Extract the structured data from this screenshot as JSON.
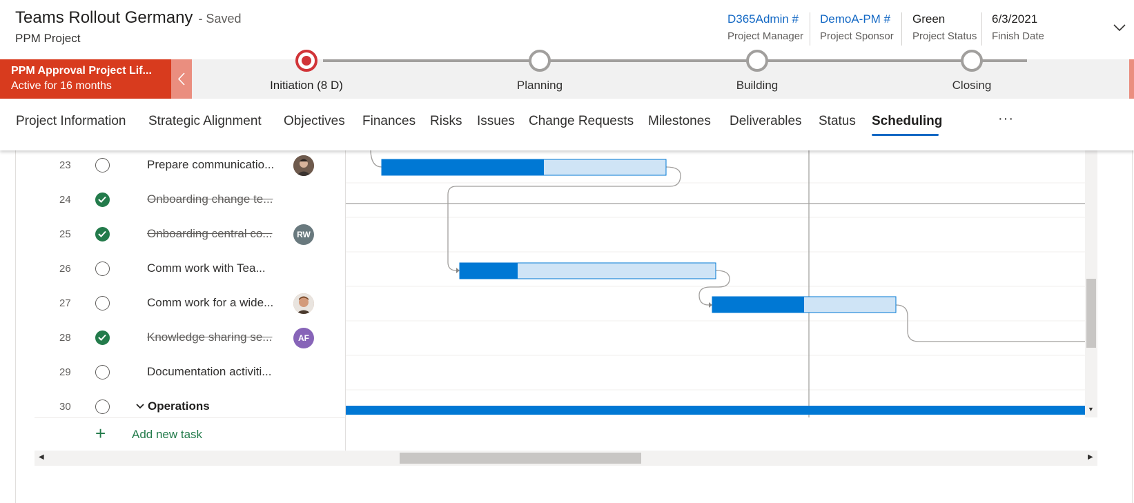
{
  "header": {
    "title": "Teams Rollout Germany",
    "saved_state": "- Saved",
    "entity_type": "PPM Project",
    "fields": [
      {
        "value": "D365Admin #",
        "label": "Project Manager",
        "is_link": true
      },
      {
        "value": "DemoA-PM #",
        "label": "Project Sponsor",
        "is_link": true
      },
      {
        "value": "Green",
        "label": "Project Status",
        "is_link": false
      },
      {
        "value": "6/3/2021",
        "label": "Finish Date",
        "is_link": false
      }
    ],
    "expand_icon": "chevron-down-icon"
  },
  "process_flow": {
    "active_process_name": "PPM Approval Project Lif...",
    "active_duration": "Active for 16 months",
    "collapse_icon": "chevron-left-icon",
    "stages": [
      {
        "label": "Initiation  (8 D)",
        "active": true
      },
      {
        "label": "Planning",
        "active": false
      },
      {
        "label": "Building",
        "active": false
      },
      {
        "label": "Closing",
        "active": false
      }
    ]
  },
  "tabs": {
    "items": [
      "Project Information",
      "Strategic Alignment",
      "Objectives",
      "Finances",
      "Risks",
      "Issues",
      "Change Requests",
      "Milestones",
      "Deliverables",
      "Status",
      "Scheduling"
    ],
    "selected": "Scheduling",
    "more_label": "···"
  },
  "schedule": {
    "tasks": [
      {
        "num": "23",
        "name": "Prepare communicatio...",
        "done": false,
        "avatar": "photo"
      },
      {
        "num": "24",
        "name": "Onboarding change te...",
        "done": true,
        "avatar": ""
      },
      {
        "num": "25",
        "name": "Onboarding central co...",
        "done": true,
        "avatar": "RW",
        "avatar_color": "#69797e"
      },
      {
        "num": "26",
        "name": "Comm work with Tea...",
        "done": false,
        "avatar": ""
      },
      {
        "num": "27",
        "name": "Comm work for a wide...",
        "done": false,
        "avatar": "photo2"
      },
      {
        "num": "28",
        "name": "Knowledge sharing se...",
        "done": true,
        "avatar": "AF",
        "avatar_color": "#8764b8"
      },
      {
        "num": "29",
        "name": "Documentation activiti...",
        "done": false,
        "avatar": ""
      },
      {
        "num": "30",
        "name": "Operations",
        "done": false,
        "group": true,
        "avatar": ""
      }
    ],
    "add_task_label": "Add new task",
    "add_icon": "plus-icon"
  },
  "colors": {
    "accent": "#1368c4",
    "bpf_active": "#d83b1e",
    "stage_active": "#d13438",
    "done": "#237b4b",
    "bar_done": "#0078d4",
    "bar_remaining": "#cfe4f6"
  }
}
